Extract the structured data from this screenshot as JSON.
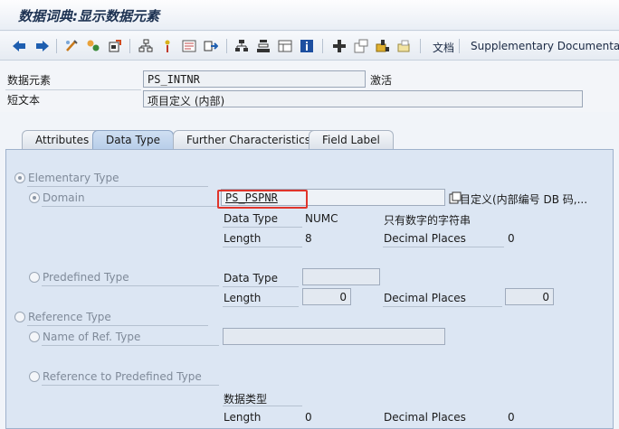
{
  "title": "数据词典:显示数据元素",
  "toolbar": {
    "icons": [
      "back-arrow-icon",
      "forward-arrow-icon",
      "display-change-icon",
      "check-icon",
      "activate-icon",
      "where-used-icon",
      "info-pin-icon",
      "navigation-icon",
      "other-object-icon",
      "hierarchy-icon",
      "stack-icon",
      "layout-icon",
      "info-icon",
      "expand-icon",
      "new-window-icon",
      "transport-icon",
      "help-icon"
    ],
    "doc_label": "文档",
    "supp_doc_label": "Supplementary Documentation"
  },
  "header": {
    "element_label": "数据元素",
    "element_value": "PS_INTNR",
    "status": "激活",
    "short_text_label": "短文本",
    "short_text_value": "项目定义 (内部)"
  },
  "tabs": [
    "Attributes",
    "Data Type",
    "Further Characteristics",
    "Field Label"
  ],
  "active_tab": "Data Type",
  "panel": {
    "elementary_type": "Elementary Type",
    "domain_label": "Domain",
    "domain_value": "PS_PSPNR",
    "domain_desc": "目定义(内部编号 DB 码,...",
    "data_type_label": "Data Type",
    "data_type_value": "NUMC",
    "data_type_desc": "只有数字的字符串",
    "length_label": "Length",
    "length_value": "8",
    "decimal_label": "Decimal Places",
    "decimal_value": "0",
    "predefined_type": "Predefined Type",
    "pre_data_type_label": "Data Type",
    "pre_length_label": "Length",
    "pre_length_value": "0",
    "pre_decimal_label": "Decimal Places",
    "pre_decimal_value": "0",
    "reference_type": "Reference Type",
    "name_ref_type": "Name of Ref. Type",
    "ref_predefined": "Reference to Predefined Type",
    "ref_data_type_label": "数据类型",
    "ref_length_label": "Length",
    "ref_length_value": "0",
    "ref_decimal_label": "Decimal Places",
    "ref_decimal_value": "0"
  },
  "colors": {
    "highlight": "#e0352b",
    "panel_bg": "#dce6f3",
    "active_tab": "#c4d7ee"
  }
}
